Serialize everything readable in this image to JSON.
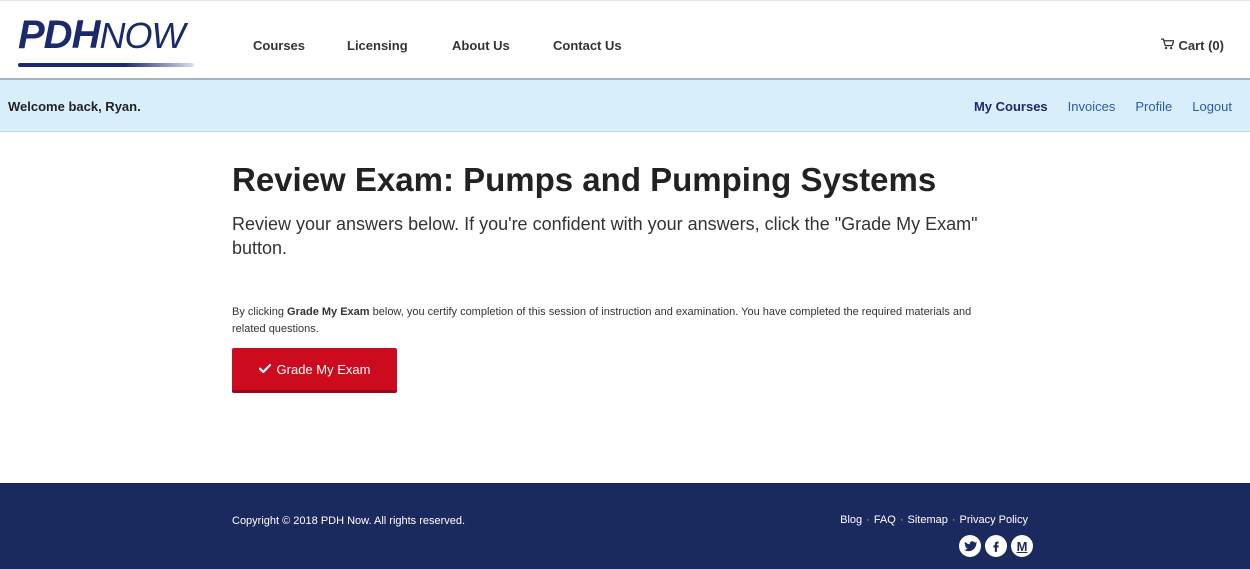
{
  "header": {
    "logo_bold": "PDH",
    "logo_light": "NOW",
    "nav": [
      {
        "label": "Courses"
      },
      {
        "label": "Licensing"
      },
      {
        "label": "About Us"
      },
      {
        "label": "Contact Us"
      }
    ],
    "cart_label": "Cart (0)"
  },
  "account_bar": {
    "welcome": "Welcome back, Ryan.",
    "links": [
      {
        "label": "My Courses"
      },
      {
        "label": "Invoices"
      },
      {
        "label": "Profile"
      },
      {
        "label": "Logout"
      }
    ]
  },
  "main": {
    "title": "Review Exam: Pumps and Pumping Systems",
    "subtitle": "Review your answers below. If you're confident with your answers, click the \"Grade My Exam\" button.",
    "certify_prefix": "By clicking ",
    "certify_bold": "Grade My Exam",
    "certify_suffix": " below, you certify completion of this session of instruction and examination. You have completed the required materials and related questions.",
    "grade_button_label": "Grade My Exam"
  },
  "footer": {
    "copyright": "Copyright © 2018 PDH Now. All rights reserved.",
    "links": [
      {
        "label": "Blog"
      },
      {
        "label": "FAQ"
      },
      {
        "label": "Sitemap"
      },
      {
        "label": "Privacy Policy"
      }
    ],
    "social": [
      {
        "icon": "twitter-icon"
      },
      {
        "icon": "facebook-icon"
      },
      {
        "icon": "medium-icon",
        "glyph": "M"
      }
    ]
  },
  "colors": {
    "brand_navy": "#1a2a6c",
    "welcome_bar": "#d9eefb",
    "primary_red": "#cc0b1e",
    "footer_bg": "#1a2a5e"
  }
}
